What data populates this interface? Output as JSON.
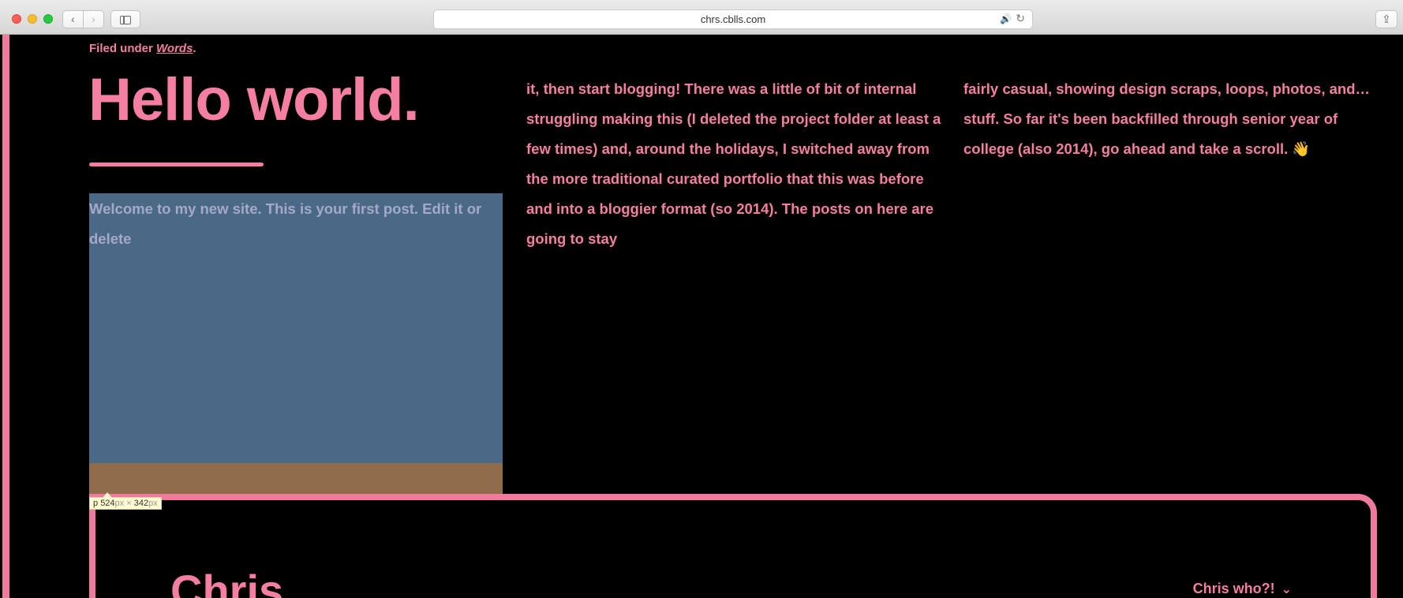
{
  "browser": {
    "url": "chrs.cblls.com",
    "back_glyph": "‹",
    "forward_glyph": "›",
    "share_glyph": "⇪",
    "audio_glyph": "🔊",
    "reload_glyph": "↻",
    "icons": [
      "close-light",
      "minimize-light",
      "zoom-light",
      "back-icon",
      "forward-icon",
      "sidebar-icon",
      "audio-icon",
      "reload-icon",
      "share-icon"
    ]
  },
  "post": {
    "filed_prefix": "Filed under",
    "filed_category": "Words",
    "filed_suffix": ".",
    "title": "Hello world.",
    "col1": "Welcome to my new site. This is your first post. Edit it or delete",
    "col2": "it, then start blogging! There was a little of bit of internal struggling making this (I deleted the project folder at least a few times) and, around the holidays, I switched away from the more traditional curated portfolio that this was before and into a bloggier format (so 2014). The posts on here are going to stay",
    "col3": "fairly casual, showing design scraps, loops, photos, and…stuff. So far it's been backfilled through senior year of college (also 2014), go ahead and take a scroll. 👋"
  },
  "inspector": {
    "tag": "p",
    "width": "524",
    "height": "342",
    "unit": "px",
    "times": "×"
  },
  "bio": {
    "name": "Chris",
    "toggle_label": "Chris who?!",
    "toggle_glyph": "⌄"
  },
  "colors": {
    "accent": "#f47fa2",
    "background": "#000000",
    "inspector_content": "#4a6986",
    "inspector_padding": "#916c4a"
  }
}
